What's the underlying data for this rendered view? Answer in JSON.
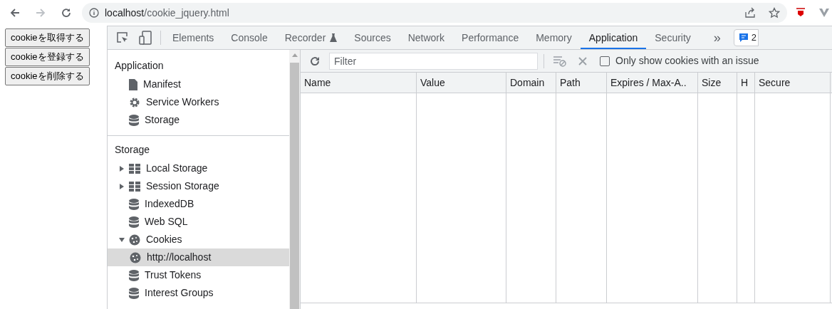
{
  "browser": {
    "url_host": "localhost",
    "url_path": "/cookie_jquery.html"
  },
  "page_buttons": [
    "cookieを取得する",
    "cookieを登録する",
    "cookieを削除する"
  ],
  "devtools": {
    "tabs": [
      {
        "label": "Elements",
        "selected": false
      },
      {
        "label": "Console",
        "selected": false
      },
      {
        "label": "Recorder",
        "selected": false,
        "experimental": true
      },
      {
        "label": "Sources",
        "selected": false
      },
      {
        "label": "Network",
        "selected": false
      },
      {
        "label": "Performance",
        "selected": false
      },
      {
        "label": "Memory",
        "selected": false
      },
      {
        "label": "Application",
        "selected": true
      },
      {
        "label": "Security",
        "selected": false
      }
    ],
    "more_tabs": "»",
    "issues_count": "2",
    "sidebar": {
      "sections": [
        {
          "title": "Application",
          "items": [
            {
              "label": "Manifest",
              "kind": "file"
            },
            {
              "label": "Service Workers",
              "kind": "gear"
            },
            {
              "label": "Storage",
              "kind": "database"
            }
          ]
        },
        {
          "title": "Storage",
          "items": [
            {
              "label": "Local Storage",
              "kind": "grid",
              "expanded": false,
              "selected": false
            },
            {
              "label": "Session Storage",
              "kind": "grid",
              "expanded": false,
              "selected": false
            },
            {
              "label": "IndexedDB",
              "kind": "database"
            },
            {
              "label": "Web SQL",
              "kind": "database"
            },
            {
              "label": "Cookies",
              "kind": "cookie",
              "expanded": true,
              "selected": false,
              "children": [
                {
                  "label": "http://localhost",
                  "kind": "cookie",
                  "selected": true
                }
              ]
            },
            {
              "label": "Trust Tokens",
              "kind": "database"
            },
            {
              "label": "Interest Groups",
              "kind": "database"
            }
          ]
        }
      ]
    },
    "filter": {
      "placeholder": "Filter"
    },
    "only_issues": {
      "label": "Only show cookies with an issue",
      "checked": false
    },
    "table": {
      "columns": [
        "Name",
        "Value",
        "Domain",
        "Path",
        "Expires / Max-A..",
        "Size",
        "H",
        "Secure"
      ]
    }
  }
}
